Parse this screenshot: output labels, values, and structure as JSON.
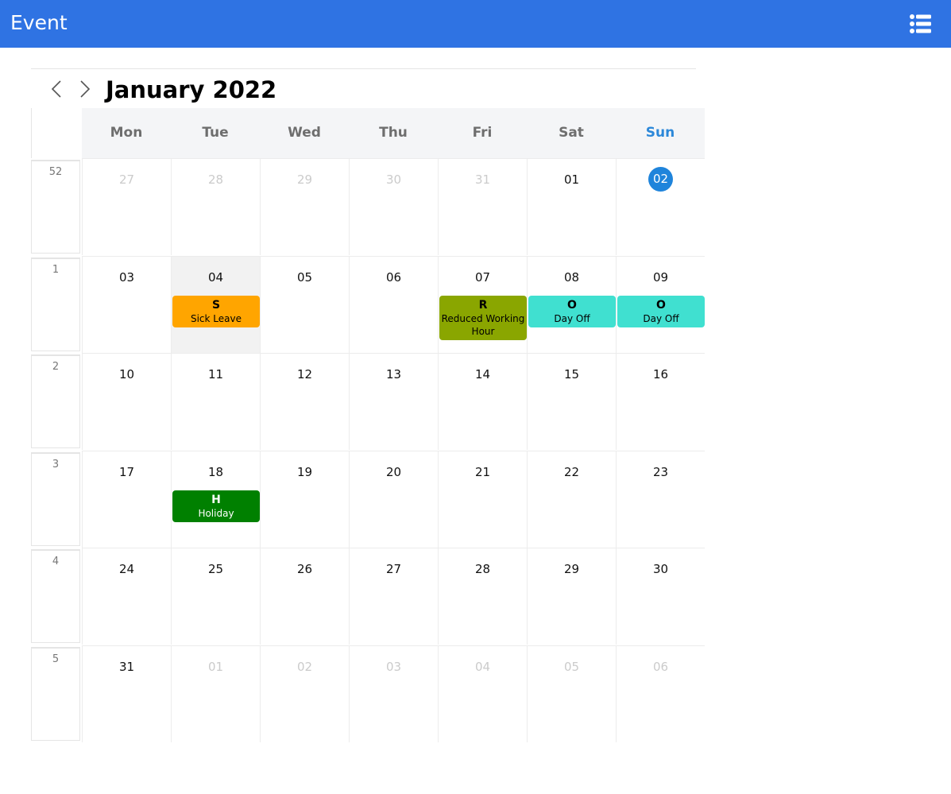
{
  "app": {
    "title": "Event",
    "menu_icon": "list-icon"
  },
  "calendar": {
    "month_title": "January 2022",
    "days_of_week": [
      "Mon",
      "Tue",
      "Wed",
      "Thu",
      "Fri",
      "Sat",
      "Sun"
    ],
    "colors": {
      "sick_leave": "#ffa500",
      "reduced_working_hour": "#8aa600",
      "day_off": "#40e0d0",
      "holiday": "#008000",
      "today": "#1f84db",
      "header": "#2f73e3"
    },
    "weeks": [
      {
        "week_no": "52",
        "days": [
          {
            "label": "27",
            "other": true
          },
          {
            "label": "28",
            "other": true
          },
          {
            "label": "29",
            "other": true
          },
          {
            "label": "30",
            "other": true
          },
          {
            "label": "31",
            "other": true
          },
          {
            "label": "01"
          },
          {
            "label": "02",
            "today": true
          }
        ]
      },
      {
        "week_no": "1",
        "days": [
          {
            "label": "03"
          },
          {
            "label": "04",
            "highlight": true,
            "event": {
              "code": "S",
              "label": "Sick Leave",
              "color": "#ffa500",
              "text_color": "#000000"
            }
          },
          {
            "label": "05"
          },
          {
            "label": "06"
          },
          {
            "label": "07",
            "event": {
              "code": "R",
              "label": "Reduced Working Hour",
              "color": "#8aa600",
              "text_color": "#000000"
            }
          },
          {
            "label": "08",
            "event": {
              "code": "O",
              "label": "Day Off",
              "color": "#40e0d0",
              "text_color": "#000000"
            }
          },
          {
            "label": "09",
            "event": {
              "code": "O",
              "label": "Day Off",
              "color": "#40e0d0",
              "text_color": "#000000"
            }
          }
        ]
      },
      {
        "week_no": "2",
        "days": [
          {
            "label": "10"
          },
          {
            "label": "11"
          },
          {
            "label": "12"
          },
          {
            "label": "13"
          },
          {
            "label": "14"
          },
          {
            "label": "15"
          },
          {
            "label": "16"
          }
        ]
      },
      {
        "week_no": "3",
        "days": [
          {
            "label": "17"
          },
          {
            "label": "18",
            "event": {
              "code": "H",
              "label": "Holiday",
              "color": "#008000",
              "text_color": "#ffffff"
            }
          },
          {
            "label": "19"
          },
          {
            "label": "20"
          },
          {
            "label": "21"
          },
          {
            "label": "22"
          },
          {
            "label": "23"
          }
        ]
      },
      {
        "week_no": "4",
        "days": [
          {
            "label": "24"
          },
          {
            "label": "25"
          },
          {
            "label": "26"
          },
          {
            "label": "27"
          },
          {
            "label": "28"
          },
          {
            "label": "29"
          },
          {
            "label": "30"
          }
        ]
      },
      {
        "week_no": "5",
        "days": [
          {
            "label": "31"
          },
          {
            "label": "01",
            "other": true
          },
          {
            "label": "02",
            "other": true
          },
          {
            "label": "03",
            "other": true
          },
          {
            "label": "04",
            "other": true
          },
          {
            "label": "05",
            "other": true
          },
          {
            "label": "06",
            "other": true
          }
        ]
      }
    ]
  }
}
